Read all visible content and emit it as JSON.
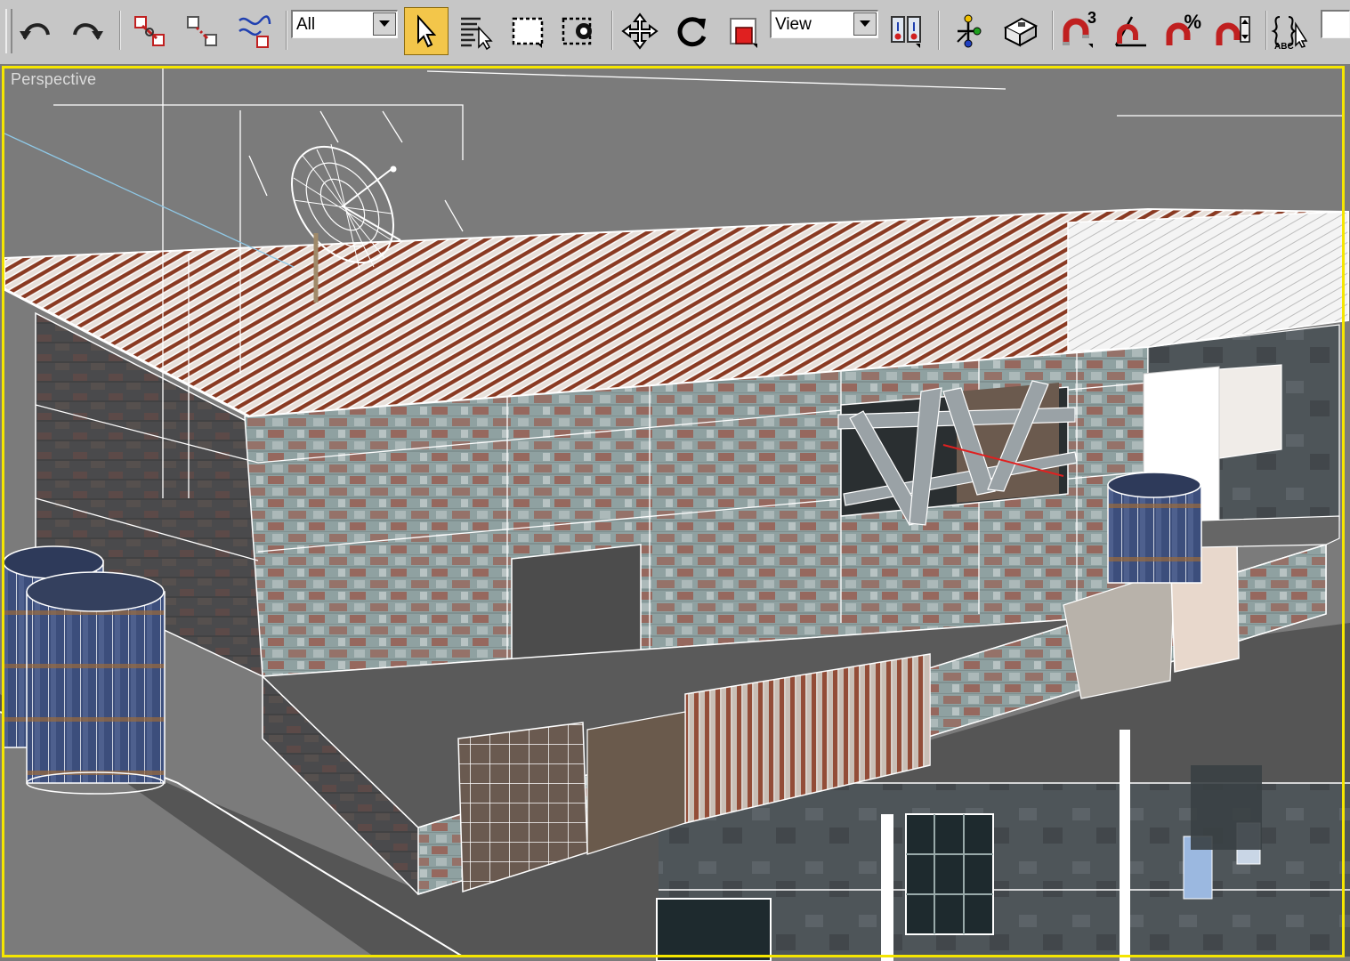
{
  "toolbar": {
    "selection_filter": {
      "selected": "All"
    },
    "reference_coordinate": {
      "selected": "View"
    },
    "buttons": [
      {
        "name": "undo-button",
        "icon": "undo-icon"
      },
      {
        "name": "redo-button",
        "icon": "redo-icon"
      },
      {
        "name": "select-and-link-button",
        "icon": "link-icon"
      },
      {
        "name": "unlink-selection-button",
        "icon": "unlink-icon"
      },
      {
        "name": "bind-to-space-warp-button",
        "icon": "space-warp-icon"
      },
      {
        "name": "select-object-button",
        "icon": "cursor-arrow-icon",
        "active": true
      },
      {
        "name": "select-by-name-button",
        "icon": "select-by-name-icon"
      },
      {
        "name": "rectangular-selection-button",
        "icon": "rect-selection-icon"
      },
      {
        "name": "window-crossing-button",
        "icon": "window-crossing-icon"
      },
      {
        "name": "select-and-move-button",
        "icon": "move-icon"
      },
      {
        "name": "select-and-rotate-button",
        "icon": "rotate-icon"
      },
      {
        "name": "select-and-scale-button",
        "icon": "scale-icon"
      },
      {
        "name": "use-pivot-center-button",
        "icon": "pivot-center-icon"
      },
      {
        "name": "select-and-manipulate-button",
        "icon": "manipulate-icon"
      },
      {
        "name": "keyboard-shortcut-override-button",
        "icon": "keyboard-override-icon"
      },
      {
        "name": "snaps-toggle-button",
        "icon": "snap-magnet-icon",
        "badge": "3"
      },
      {
        "name": "angle-snap-button",
        "icon": "angle-snap-icon"
      },
      {
        "name": "percent-snap-button",
        "icon": "percent-snap-icon",
        "badge": "%"
      },
      {
        "name": "spinner-snap-button",
        "icon": "spinner-snap-icon"
      },
      {
        "name": "edit-named-selection-button",
        "icon": "named-selection-icon",
        "caption": "ABC"
      }
    ]
  },
  "viewport": {
    "label": "Perspective",
    "active_border_color": "#f5e600",
    "background_color": "#7b7b7b"
  },
  "scene": {
    "objects": [
      "corrugated-roof",
      "satellite-dish",
      "brick-wall",
      "window-boards",
      "oil-barrel",
      "oil-barrel",
      "oil-barrel",
      "rusty-sheet",
      "wire-mesh",
      "wooden-plank",
      "cloth",
      "lower-floor",
      "broken-window",
      "poster"
    ]
  },
  "colors": {
    "wireframe": "#ffffff",
    "brick_plaster": "#8ea0a0",
    "brick_red": "#9a4a3a",
    "rust": "#8a3a22",
    "barrel_blue": "#3c4e7c",
    "selection_yellow": "#f3c64a"
  }
}
